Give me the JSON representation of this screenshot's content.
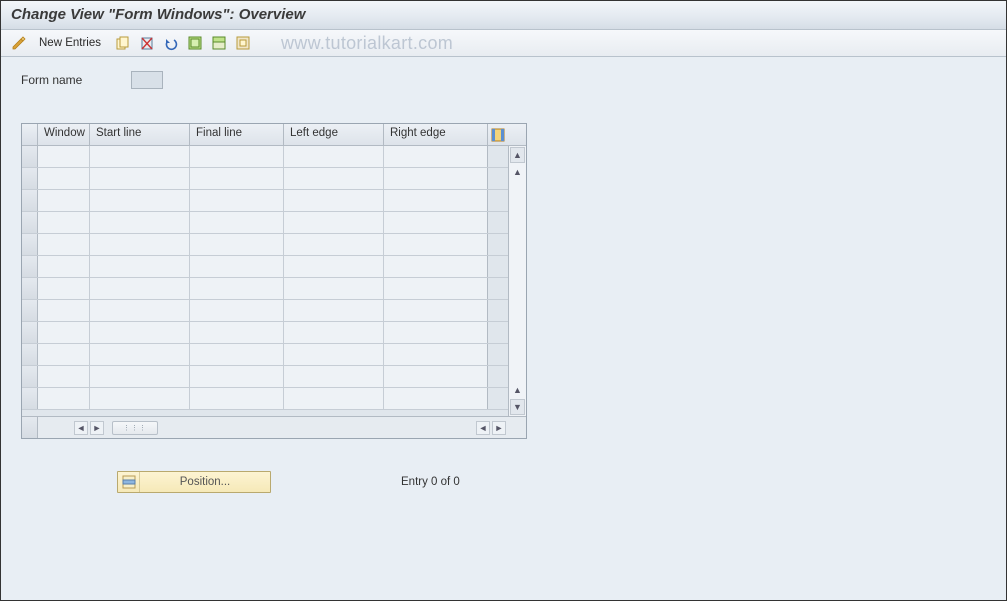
{
  "title": "Change View \"Form Windows\": Overview",
  "toolbar": {
    "new_entries": "New Entries"
  },
  "watermark": "www.tutorialkart.com",
  "form": {
    "name_label": "Form name",
    "name_value": ""
  },
  "grid": {
    "columns": {
      "window": "Window",
      "start_line": "Start line",
      "final_line": "Final line",
      "left_edge": "Left edge",
      "right_edge": "Right edge"
    },
    "rows": []
  },
  "footer": {
    "position_label": "Position...",
    "entry_status": "Entry 0 of 0"
  }
}
